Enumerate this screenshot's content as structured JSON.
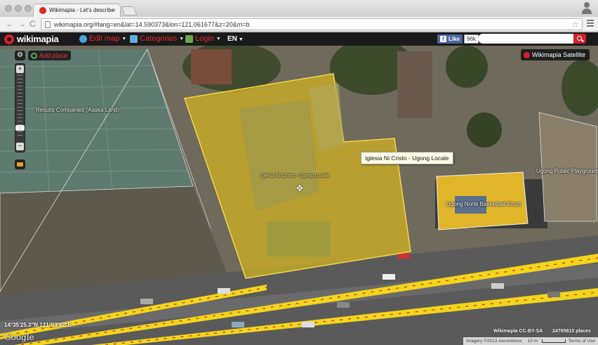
{
  "browser": {
    "tab_title": "Wikimapia - Let's describe",
    "tab_close": "×",
    "url": "wikimapia.org/#lang=en&lat=14.590373&lon=121.061677&z=20&m=b",
    "back": "←",
    "forward": "→",
    "reload": "C"
  },
  "header": {
    "logo": "wikimapia",
    "edit_map": "Edit map",
    "categories": "Categories",
    "login": "Login",
    "lang": "EN",
    "fb_like": "Like",
    "fb_count": "96k",
    "search_placeholder": ""
  },
  "map": {
    "add_place": "Add place",
    "satellite_label": "Wikimapia Satellite",
    "labels": {
      "results_companies": "Results Companies (Aaska Land)",
      "iglesia_in_map": "Iglesia Ni Cristo - Ugong Locale",
      "ugong_playground": "Ugong Public Playground",
      "basketball_court": "Ugong Norte Basketball Court"
    },
    "tooltip": "Iglesia Ni Cristo - Ugong Locale",
    "coordinates": "14°35'25.3\"N 121°03'42\"E",
    "google": "Google",
    "attribution": "Wikimapia CC-BY-SA",
    "places_count": "24765810 places",
    "bottom": {
      "imagery": "Imagery ©2013 Aerometrex",
      "scale": "10 m",
      "terms": "Terms of Use"
    },
    "colors": {
      "polygon_fill": "#d4b41e",
      "road_highlight": "#f2d61a",
      "accent": "#d4202a"
    }
  }
}
